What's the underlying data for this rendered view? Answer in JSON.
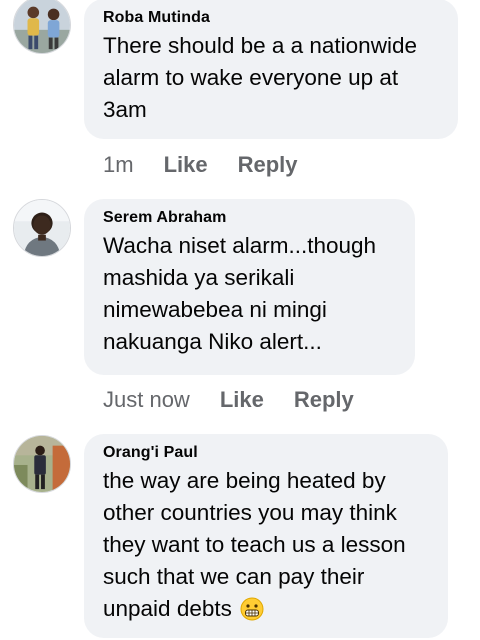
{
  "comments": [
    {
      "author": "Roba Mutinda",
      "text": "There should be a a nationwide\nalarm to wake everyone up at\n3am",
      "time": "1m",
      "like_label": "Like",
      "reply_label": "Reply"
    },
    {
      "author": "Serem Abraham",
      "text": "Wacha niset alarm...though\nmashida ya serikali\nnimewabebea ni mingi\nnakuanga Niko alert...",
      "time": "Just now",
      "like_label": "Like",
      "reply_label": "Reply"
    },
    {
      "author": "Orang'i Paul",
      "text": "the way are being heated by\nother countries you may think\nthey want to teach us a lesson\nsuch that we can pay their\nunpaid debts",
      "emoji": "grimacing-face-emoji"
    }
  ],
  "colors": {
    "bubble": "#f0f2f5",
    "text": "#050505",
    "meta": "#65676b"
  }
}
